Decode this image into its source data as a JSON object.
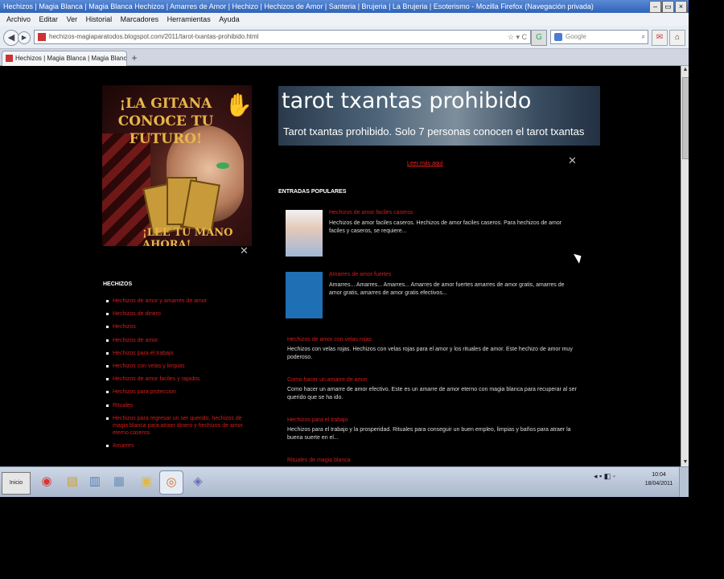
{
  "window": {
    "title": "Hechizos | Magia Blanca | Magia Blanca Hechizos | Amarres de Amor | Hechizo | Hechizos de Amor | Santeria | Brujeria | La Brujeria | Esoterismo - Mozilla Firefox (Navegación privada)",
    "controls": [
      "–",
      "▭",
      "×"
    ]
  },
  "menu": [
    "Archivo",
    "Editar",
    "Ver",
    "Historial",
    "Marcadores",
    "Herramientas",
    "Ayuda"
  ],
  "nav": {
    "back": "◀",
    "forward": "▶",
    "url": "hechizos-magiaparatodos.blogspot.com/2011/tarot-txantas-prohibido.html",
    "url_icons": "☆ ▾ C",
    "google_btn": "G",
    "search_placeholder": "Google",
    "search_btn": "⌕",
    "toolbar_icon_a": "✉",
    "toolbar_icon_b": "⌂"
  },
  "tab": {
    "label": "Hechizos | Magia Blanca | Magia Blanca Hechi...",
    "new_tab": "+"
  },
  "banner": {
    "headline": "¡LA GITANA CONOCE TU FUTURO!",
    "footer": "¡LEE TU MANO AHORA!"
  },
  "sidebar": {
    "heading": "HECHIZOS",
    "items": [
      "Hechizos de amor y amarres de amor",
      "Hechizos de dinero",
      "Hechizos",
      "Hechizos de amor",
      "Hechizos para el trabajo",
      "Hechizos con velas y limpias",
      "Hechizos de amor faciles y rapidos",
      "Hechizos para proteccion",
      "Rituales",
      "Hechizos para regresar un ser querido, hechizos de magia blanca para atraer dinero y hechizos de amor eterno caseros",
      "Amarres"
    ]
  },
  "header": {
    "title": "tarot txantas prohibido",
    "subtitle": "Tarot txantas prohibido. Solo 7 personas conocen el tarot txantas"
  },
  "main": {
    "top_link": "Leer más aquí",
    "popular_heading": "ENTRADAS POPULARES",
    "popular_posts": [
      {
        "title": "Hechizos de amor faciles caseros",
        "text": "Hechizos de amor faciles caseros. Hechizos de amor faciles caseros. Para hechizos de amor faciles y caseros, se requiere..."
      },
      {
        "title": "Amarres de amor fuertes",
        "text": "Amarres... Amarres... Amarres... Amarres de amor fuertes amarres de amor gratis, amarres de amor gratis, amarres de amor gratis efectivos..."
      }
    ],
    "articles": [
      {
        "title": "Hechizos de amor con velas rojas",
        "text": "Hechizos con velas rojas. Hechizos con velas rojas para el amor y los rituales de amor. Este hechizo de amor muy poderoso."
      },
      {
        "title": "Como hacer un amarre de amor",
        "text": "Como hacer un amarre de amor efectivo. Este es un amarre de amor eterno con magia blanca para recuperar al ser querido que se ha ido."
      },
      {
        "title": "Hechizos para el trabajo",
        "text": "Hechizos para el trabajo y la prosperidad. Rituales para conseguir un buen empleo, limpias y baños para atraer la buena suerte en el..."
      },
      {
        "title": "Rituales de magia blanca",
        "text": ""
      }
    ],
    "tools_icon": "✕"
  },
  "taskbar": {
    "start": "Inicio",
    "apps": [
      {
        "name": "chrome",
        "glyph": "◉",
        "color": "#d33"
      },
      {
        "name": "explorer",
        "glyph": "▤",
        "color": "#c9a23b"
      },
      {
        "name": "media",
        "glyph": "▥",
        "color": "#5a7fb5"
      },
      {
        "name": "notepad",
        "glyph": "▦",
        "color": "#6f8fb6"
      },
      {
        "name": "folder",
        "glyph": "▣",
        "color": "#e0b84a"
      },
      {
        "name": "firefox",
        "glyph": "◎",
        "color": "#e26a1c"
      },
      {
        "name": "other",
        "glyph": "◈",
        "color": "#6b6fb8"
      }
    ],
    "tray_icons": "◂ ▪ ◧ ◦",
    "clock_time": "10:04",
    "clock_date": "18/04/2011"
  }
}
